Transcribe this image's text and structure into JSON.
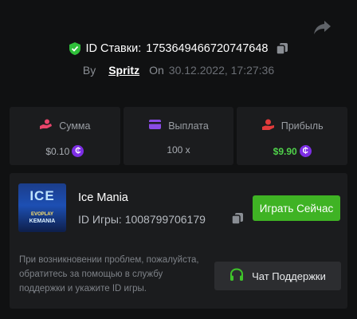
{
  "header": {
    "bet_id_label": "ID Ставки:",
    "bet_id_value": "1753649466720747648",
    "by_label": "By",
    "username": "Spritz",
    "on_label": "On",
    "datetime": "30.12.2022, 17:27:36"
  },
  "stats": [
    {
      "label": "Сумма",
      "value": "$0.10",
      "icon": "hand-coins-icon",
      "currency_icon": "coin-icon"
    },
    {
      "label": "Выплата",
      "value": "100 x",
      "icon": "wallet-icon"
    },
    {
      "label": "Прибыль",
      "value": "$9.90",
      "icon": "profit-hand-icon",
      "currency_icon": "coin-icon"
    }
  ],
  "game": {
    "name": "Ice Mania",
    "id_label": "ID Игры:",
    "id_value": "1008799706179",
    "thumb_title": "ICE",
    "thumb_brand": "EVOPLAY",
    "thumb_sub": "KEMANIA",
    "play_label": "Играть Сейчас"
  },
  "support": {
    "text": "При возникновении проблем, пожалуйста, обратитесь за помощью в службу поддержки и укажите ID игры.",
    "button_label": "Чат Поддержки"
  },
  "colors": {
    "background": "#101112",
    "card": "#1b1c1e",
    "accent_green": "#3fb324",
    "profit_green": "#4fd14a",
    "coin_purple": "#7d2ee6",
    "stake_pink": "#e8456b",
    "payout_purple": "#8a4ce6",
    "profit_red": "#e23b3b"
  }
}
